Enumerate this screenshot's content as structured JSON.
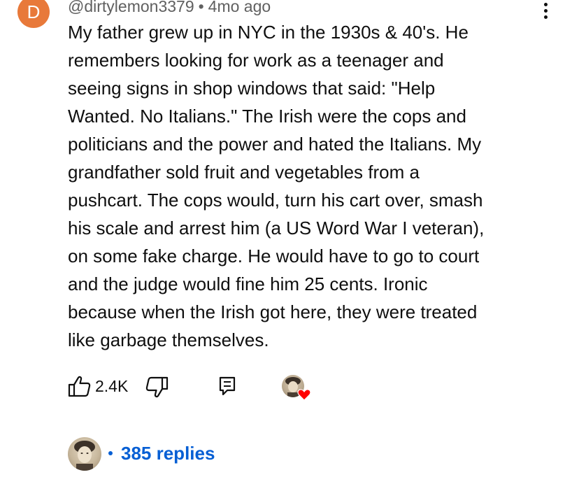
{
  "comment": {
    "author_initial": "D",
    "author_handle": "@dirtylemon3379",
    "separator": "•",
    "timestamp": "4mo ago",
    "lines": [
      "My father grew up in NYC in the 1930s & 40's. He",
      "remembers looking for work as a teenager and",
      "seeing signs in shop windows that said: \"Help",
      "Wanted. No Italians.\" The Irish were the cops and",
      "politicians and the power and hated the Italians. My",
      "grandfather sold fruit and vegetables from a",
      "pushcart. The cops would, turn his cart over, smash",
      "his scale and arrest him (a US Word War I veteran),",
      "on some fake charge. He would have to go to court",
      "and the judge would fine him 25 cents. Ironic",
      "because when the Irish got here, they were treated",
      "like garbage themselves."
    ],
    "avatar_color": "#e8793a"
  },
  "actions": {
    "like_count": "2.4K",
    "icons": [
      "thumbs-up-icon",
      "thumbs-down-icon",
      "reply-icon",
      "creator-heart-icon"
    ],
    "heart_color": "#ff0000"
  },
  "replies": {
    "label": "385 replies",
    "link_color": "#065fd4"
  }
}
